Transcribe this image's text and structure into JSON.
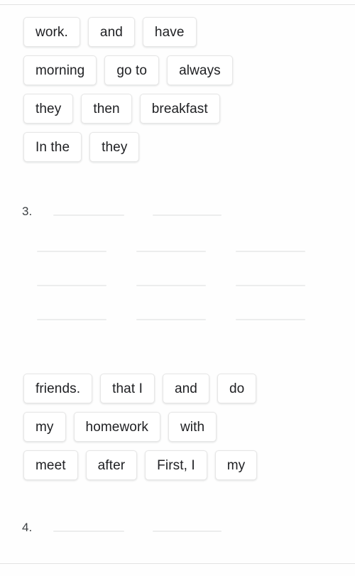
{
  "page": {
    "background_color": "#fefefe",
    "divider_color": "#e3e3e3",
    "chip_background": "#ffffff",
    "chip_border_color": "#e6e6e6",
    "blank_line_color": "#eceded",
    "text_color": "#202124"
  },
  "exercises": [
    {
      "id": "exercise-3",
      "number": "3.",
      "word_bank": [
        [
          "work.",
          "and",
          "have"
        ],
        [
          "morning",
          "go to",
          "always"
        ],
        [
          "they",
          "then",
          "breakfast"
        ],
        [
          "In the",
          "they"
        ]
      ],
      "answer_rows": [
        [
          "",
          ""
        ],
        [
          "",
          "",
          ""
        ],
        [
          "",
          "",
          ""
        ],
        [
          "",
          "",
          ""
        ]
      ]
    },
    {
      "id": "exercise-4",
      "number": "4.",
      "word_bank": [
        [
          "friends.",
          "that I",
          "and",
          "do"
        ],
        [
          "my",
          "homework",
          "with"
        ],
        [
          "meet",
          "after",
          "First, I",
          "my"
        ]
      ],
      "answer_rows": [
        [
          "",
          ""
        ]
      ]
    }
  ]
}
